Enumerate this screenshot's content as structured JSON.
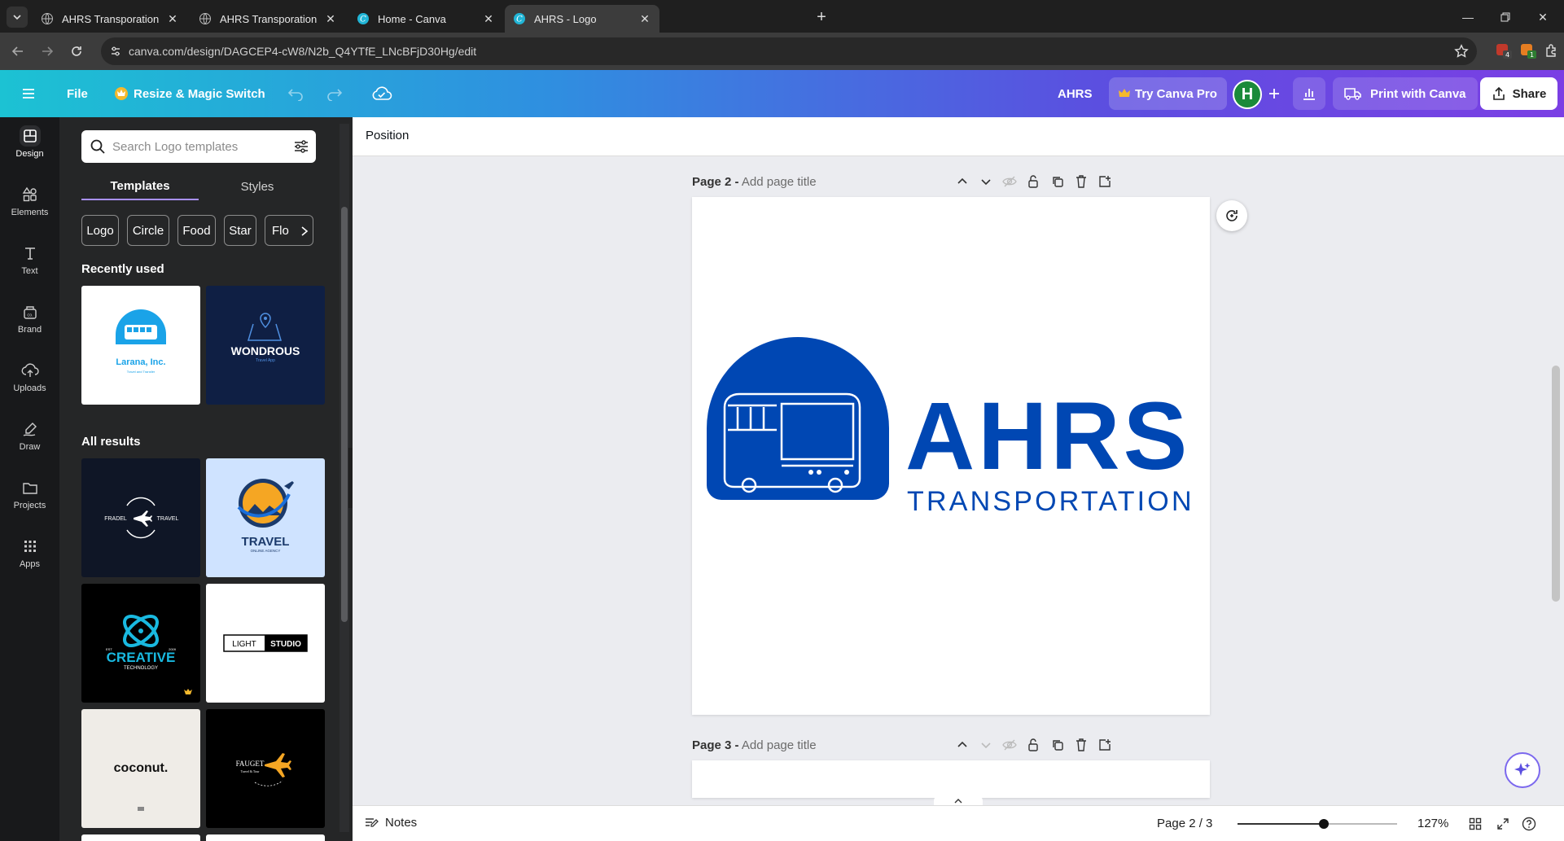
{
  "browser": {
    "tabs": [
      {
        "title": "AHRS Transporation",
        "active": false
      },
      {
        "title": "AHRS Transporation",
        "active": false
      },
      {
        "title": "Home - Canva",
        "active": false
      },
      {
        "title": "AHRS - Logo",
        "active": true
      }
    ],
    "url": "canva.com/design/DAGCEP4-cW8/N2b_Q4YTfE_LNcBFjD30Hg/edit",
    "extension_badges": [
      "4",
      "1"
    ],
    "profile_initial": "H"
  },
  "header": {
    "file_label": "File",
    "resize_label": "Resize & Magic Switch",
    "design_name": "AHRS",
    "try_pro_label": "Try Canva Pro",
    "avatar_initial": "H",
    "print_label": "Print with Canva",
    "share_label": "Share"
  },
  "rail": [
    {
      "label": "Design",
      "icon": "design-icon"
    },
    {
      "label": "Elements",
      "icon": "elements-icon"
    },
    {
      "label": "Text",
      "icon": "text-icon"
    },
    {
      "label": "Brand",
      "icon": "brand-icon"
    },
    {
      "label": "Uploads",
      "icon": "uploads-icon"
    },
    {
      "label": "Draw",
      "icon": "draw-icon"
    },
    {
      "label": "Projects",
      "icon": "projects-icon"
    },
    {
      "label": "Apps",
      "icon": "apps-icon"
    }
  ],
  "panel": {
    "search_placeholder": "Search Logo templates",
    "tabs": [
      "Templates",
      "Styles"
    ],
    "chips": [
      "Logo",
      "Circle",
      "Food",
      "Star",
      "Flo"
    ],
    "recently_used_heading": "Recently used",
    "all_results_heading": "All results",
    "recent": [
      {
        "name": "Larana, Inc.",
        "tagline": "Travel and Transfer"
      },
      {
        "name": "WONDROUS",
        "tagline": "Travel App"
      }
    ],
    "results": [
      {
        "name_left": "FRADEL",
        "name_right": "TRAVEL"
      },
      {
        "name": "TRAVEL",
        "tagline": "ONLINE AGENCY"
      },
      {
        "name": "CREATIVE",
        "tagline": "TECHNOLOGY",
        "est": "EST",
        "year": "2009"
      },
      {
        "name_left": "LIGHT",
        "name_right": "STUDIO"
      },
      {
        "name": "coconut."
      },
      {
        "name": "FAUGET",
        "tagline": "Travel & Tour"
      }
    ]
  },
  "context_bar": {
    "position_label": "Position"
  },
  "pages": [
    {
      "label": "Page 2 -",
      "placeholder": "Add page title"
    },
    {
      "label": "Page 3 -",
      "placeholder": "Add page title"
    }
  ],
  "logo": {
    "title": "AHRS",
    "subtitle": "TRANSPORTATION",
    "color": "#0047b3"
  },
  "footer": {
    "notes_label": "Notes",
    "page_indicator": "Page 2 / 3",
    "zoom_label": "127%",
    "zoom_fraction": 0.54
  },
  "colors": {
    "accent": "#8b3dff",
    "brand_blue": "#0047b3"
  }
}
